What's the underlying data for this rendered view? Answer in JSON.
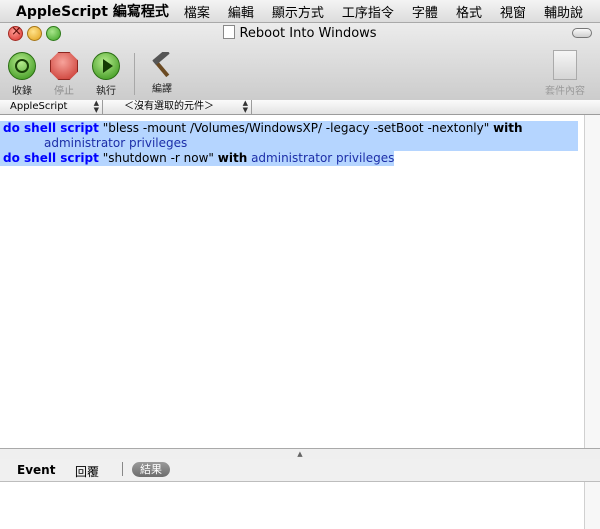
{
  "menubar": {
    "app": "AppleScript 編寫程式",
    "items": [
      "檔案",
      "編輯",
      "顯示方式",
      "工序指令",
      "字體",
      "格式",
      "視窗",
      "輔助說"
    ]
  },
  "window": {
    "title": "Reboot Into Windows"
  },
  "toolbar": {
    "record_label": "收錄",
    "stop_label": "停止",
    "run_label": "執行",
    "compile_label": "編譯",
    "bundle_label": "套件內容"
  },
  "navbar": {
    "language": "AppleScript",
    "element": "＜沒有選取的元件＞"
  },
  "script": {
    "line1": {
      "kw": "do shell script",
      "str": "\"bless -mount /Volumes/WindowsXP/ -legacy -setBoot -nextonly\"",
      "with": "with",
      "term": "administrator privileges"
    },
    "line2": {
      "kw": "do shell script",
      "str": "\"shutdown -r now\"",
      "with": "with",
      "term": "administrator privileges"
    }
  },
  "tabs": {
    "event": "Event",
    "reply": "回覆",
    "result": "結果"
  },
  "colors": {
    "keyword": "#0000ff",
    "term": "#1c2ea8",
    "selection": "#b5d5ff"
  }
}
